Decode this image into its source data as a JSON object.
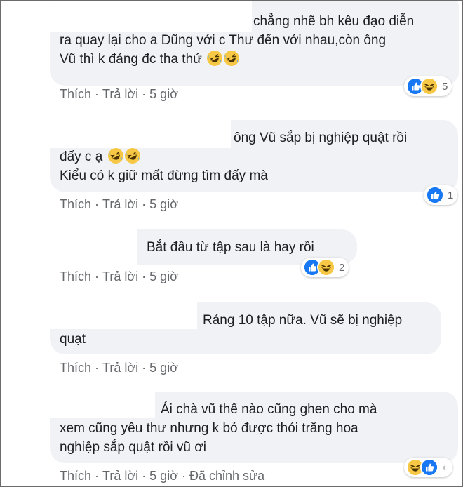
{
  "comments": [
    {
      "lines": [
        "chẳng nhẽ bh kêu đạo diễn",
        "ra quay lại cho a Dũng với c Thư đến với nhau,còn ông",
        "Vũ thì k đáng đc tha thứ"
      ],
      "actions": {
        "like": "Thích",
        "reply": "Trả lời",
        "time": "5 giờ"
      },
      "reaction_count": "5",
      "reactions": [
        "like-icon",
        "haha-icon"
      ]
    },
    {
      "lines": [
        "ông Vũ sắp bị nghiệp quật rồi",
        "đấy c ạ",
        "Kiểu có k giữ mất đừng tìm đấy mà"
      ],
      "actions": {
        "like": "Thích",
        "reply": "Trả lời",
        "time": "5 giờ"
      },
      "reaction_count": "1",
      "reactions": [
        "like-icon"
      ]
    },
    {
      "lines": [
        "Bắt đầu từ tập sau là hay rồi"
      ],
      "actions": {
        "like": "Thích",
        "reply": "Trả lời",
        "time": "5 giờ"
      },
      "reaction_count": "2",
      "reactions": [
        "like-icon",
        "haha-icon"
      ]
    },
    {
      "lines": [
        "Ráng 10 tập nữa. Vũ sẽ bị nghiệp",
        "quạt"
      ],
      "actions": {
        "like": "Thích",
        "reply": "Trả lời",
        "time": "5 giờ"
      },
      "reaction_count": "",
      "reactions": []
    },
    {
      "lines": [
        "Ái chà vũ thế nào cũng ghen cho mà",
        "xem cũng yêu thư nhưng k bỏ được thói trăng hoa",
        "nghiệp sắp quật rồi vũ ơi"
      ],
      "actions": {
        "like": "Thích",
        "reply": "Trả lời",
        "time": "5 giờ",
        "edited": "Đã chỉnh sửa"
      },
      "reaction_count": "",
      "reactions": [
        "haha-icon",
        "like-icon"
      ]
    }
  ],
  "colors": {
    "bubble": "#f0f2f5",
    "text": "#1c1e21",
    "meta": "#65676b",
    "like": "#1877f2",
    "haha": "#f7c845"
  }
}
